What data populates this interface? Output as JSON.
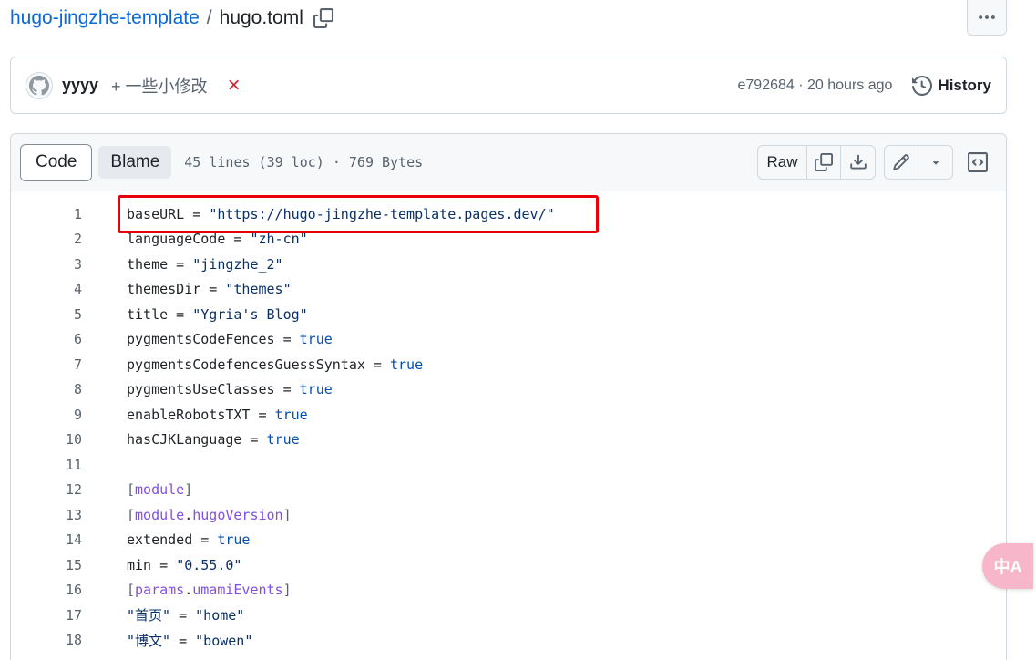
{
  "breadcrumb": {
    "repo": "hugo-jingzhe-template",
    "separator": "/",
    "file": "hugo.toml"
  },
  "more_button": {
    "icon": "kebab-horizontal-icon",
    "label": "···"
  },
  "commit": {
    "author": "yyyy",
    "message": "+ 一些小修改",
    "status_icon": "×",
    "meta": "e792684 · 20 hours ago",
    "history_label": "History"
  },
  "file_header": {
    "tab_code": "Code",
    "tab_blame": "Blame",
    "info": "45 lines (39 loc) · 769 Bytes",
    "raw_label": "Raw"
  },
  "code_lines": [
    {
      "n": "1",
      "key": "baseURL",
      "op": " = ",
      "val": "\"https://hugo-jingzhe-template.pages.dev/\"",
      "kind": "str"
    },
    {
      "n": "2",
      "key": "languageCode",
      "op": " = ",
      "val": "\"zh-cn\"",
      "kind": "str"
    },
    {
      "n": "3",
      "key": "theme",
      "op": " = ",
      "val": "\"jingzhe_2\"",
      "kind": "str"
    },
    {
      "n": "4",
      "key": "themesDir",
      "op": " = ",
      "val": "\"themes\"",
      "kind": "str"
    },
    {
      "n": "5",
      "key": "title",
      "op": " = ",
      "val": "\"Ygria's Blog\"",
      "kind": "str"
    },
    {
      "n": "6",
      "key": "pygmentsCodeFences",
      "op": " = ",
      "val": "true",
      "kind": "kw"
    },
    {
      "n": "7",
      "key": "pygmentsCodefencesGuessSyntax",
      "op": " = ",
      "val": "true",
      "kind": "kw"
    },
    {
      "n": "8",
      "key": "pygmentsUseClasses",
      "op": " = ",
      "val": "true",
      "kind": "kw"
    },
    {
      "n": "9",
      "key": "enableRobotsTXT",
      "op": " = ",
      "val": "true",
      "kind": "kw"
    },
    {
      "n": "10",
      "key": "hasCJKLanguage",
      "op": " = ",
      "val": "true",
      "kind": "kw"
    },
    {
      "n": "11",
      "key": "",
      "op": "",
      "val": "",
      "kind": "blank"
    },
    {
      "n": "12",
      "key": "module",
      "op": "",
      "val": "",
      "kind": "section"
    },
    {
      "n": "13",
      "key": "module",
      "op": ".",
      "val": "hugoVersion",
      "kind": "section2"
    },
    {
      "n": "14",
      "key": "extended",
      "op": " = ",
      "val": "true",
      "kind": "kw"
    },
    {
      "n": "15",
      "key": "min",
      "op": " = ",
      "val": "\"0.55.0\"",
      "kind": "str"
    },
    {
      "n": "16",
      "key": "params",
      "op": ".",
      "val": "umamiEvents",
      "kind": "section2"
    },
    {
      "n": "17",
      "key": "\"首页\"",
      "op": " = ",
      "val": "\"home\"",
      "kind": "str"
    },
    {
      "n": "18",
      "key": "\"博文\"",
      "op": " = ",
      "val": "\"bowen\"",
      "kind": "str"
    }
  ],
  "translate_fab": {
    "icon": "translate-icon",
    "label": "中A"
  },
  "colors": {
    "link": "#0969da",
    "string": "#0a3069",
    "keyword": "#0550ae",
    "section": "#8250df",
    "highlight": "#e8000b",
    "status_x": "#cf222e"
  }
}
